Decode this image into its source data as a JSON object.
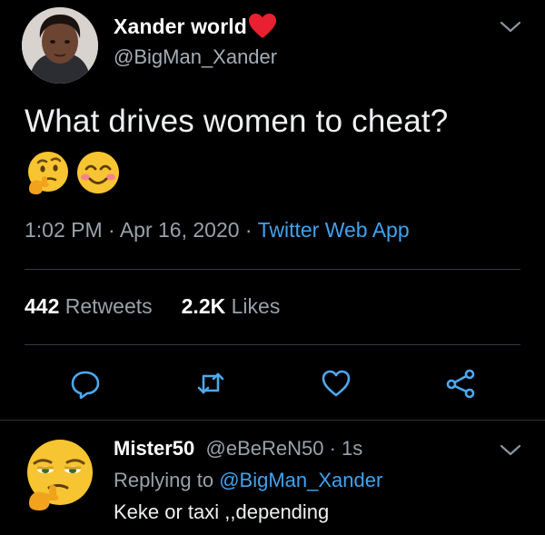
{
  "tweet": {
    "author": {
      "display_name": "Xander world",
      "name_emoji": "red-heart",
      "handle": "@BigMan_Xander"
    },
    "text": "What drives women to cheat?",
    "emojis": [
      "thinking-face-emoji",
      "smiling-face-emoji"
    ],
    "time": "1:02 PM",
    "separator": " · ",
    "date": "Apr 16, 2020",
    "source": "Twitter Web App",
    "stats": {
      "retweets_count": "442",
      "retweets_label": " Retweets",
      "likes_count": "2.2K",
      "likes_label": " Likes"
    },
    "actions": [
      "reply-icon",
      "retweet-icon",
      "like-icon",
      "share-icon"
    ]
  },
  "reply": {
    "author": {
      "display_name": "Mister50",
      "handle": "@eBeReN50",
      "time": "1s"
    },
    "replying_prefix": "Replying to ",
    "replying_to": "@BigMan_Xander",
    "text": "Keke or taxi ,,depending"
  },
  "colors": {
    "background": "#000000",
    "accent": "#3fa3f0",
    "secondary_text": "#98a2ab",
    "divider": "#353b41"
  }
}
